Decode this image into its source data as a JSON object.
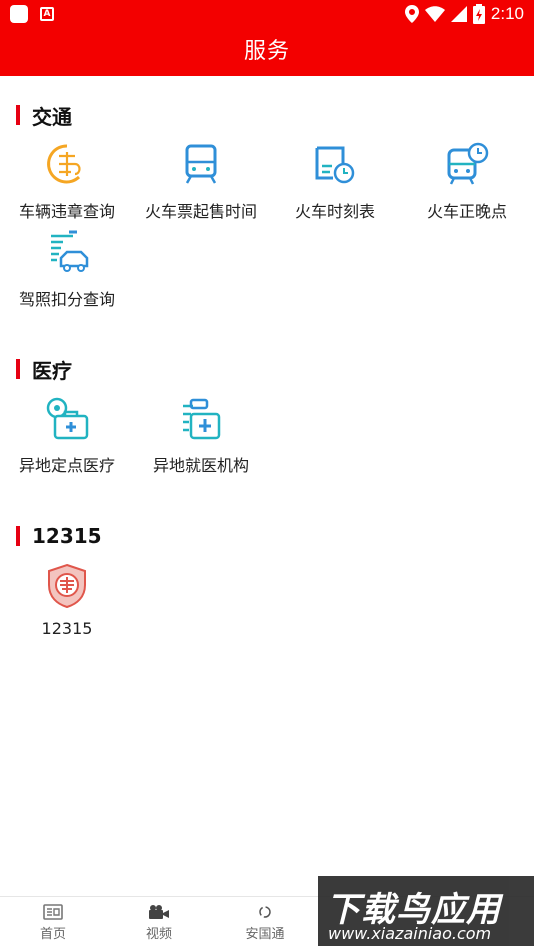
{
  "status_bar": {
    "time": "2:10"
  },
  "header": {
    "title": "服务"
  },
  "sections": [
    {
      "title": "交通",
      "items": [
        {
          "label": "车辆违章查询",
          "icon": "violation-icon"
        },
        {
          "label": "火车票起售时间",
          "icon": "train-icon"
        },
        {
          "label": "火车时刻表",
          "icon": "timetable-icon"
        },
        {
          "label": "火车正晚点",
          "icon": "train-clock-icon"
        },
        {
          "label": "驾照扣分查询",
          "icon": "license-car-icon"
        }
      ]
    },
    {
      "title": "医疗",
      "items": [
        {
          "label": "异地定点医疗",
          "icon": "medical-kit-icon"
        },
        {
          "label": "异地就医机构",
          "icon": "hospital-icon"
        }
      ]
    },
    {
      "title": "12315",
      "items": [
        {
          "label": "12315",
          "icon": "consumer-shield-icon"
        }
      ]
    }
  ],
  "tabbar": {
    "tabs": [
      {
        "label": "首页",
        "icon": "home-news-icon"
      },
      {
        "label": "视频",
        "icon": "video-camera-icon"
      },
      {
        "label": "安国通",
        "icon": "circle-logo-icon"
      }
    ]
  },
  "watermark": {
    "main": "下载鸟应用",
    "sub": "www.xiazainiao.com"
  },
  "colors": {
    "brand_red": "#f30000",
    "accent_red": "#e60012",
    "icon_blue": "#2f8fd8",
    "icon_teal": "#21b3c1",
    "icon_orange": "#f5a623"
  }
}
